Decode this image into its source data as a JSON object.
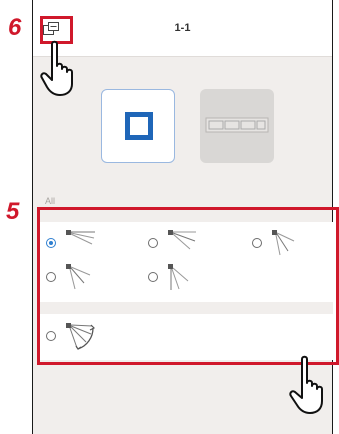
{
  "header": {
    "title": "1-1"
  },
  "steps": {
    "step5": "5",
    "step6": "6"
  },
  "section": {
    "all_label": "All"
  },
  "options": {
    "row1": [
      {
        "icon": "louver-position-1-icon",
        "selected": true
      },
      {
        "icon": "louver-position-2-icon",
        "selected": false
      },
      {
        "icon": "louver-position-3-icon",
        "selected": false
      }
    ],
    "row2": [
      {
        "icon": "louver-position-4-icon",
        "selected": false
      },
      {
        "icon": "louver-position-5-icon",
        "selected": false
      }
    ],
    "swing": {
      "icon": "swing-icon",
      "selected": false
    }
  },
  "colors": {
    "annotation": "#d0182b",
    "accent": "#2f7fd0",
    "unit_blue": "#1f66b8"
  }
}
